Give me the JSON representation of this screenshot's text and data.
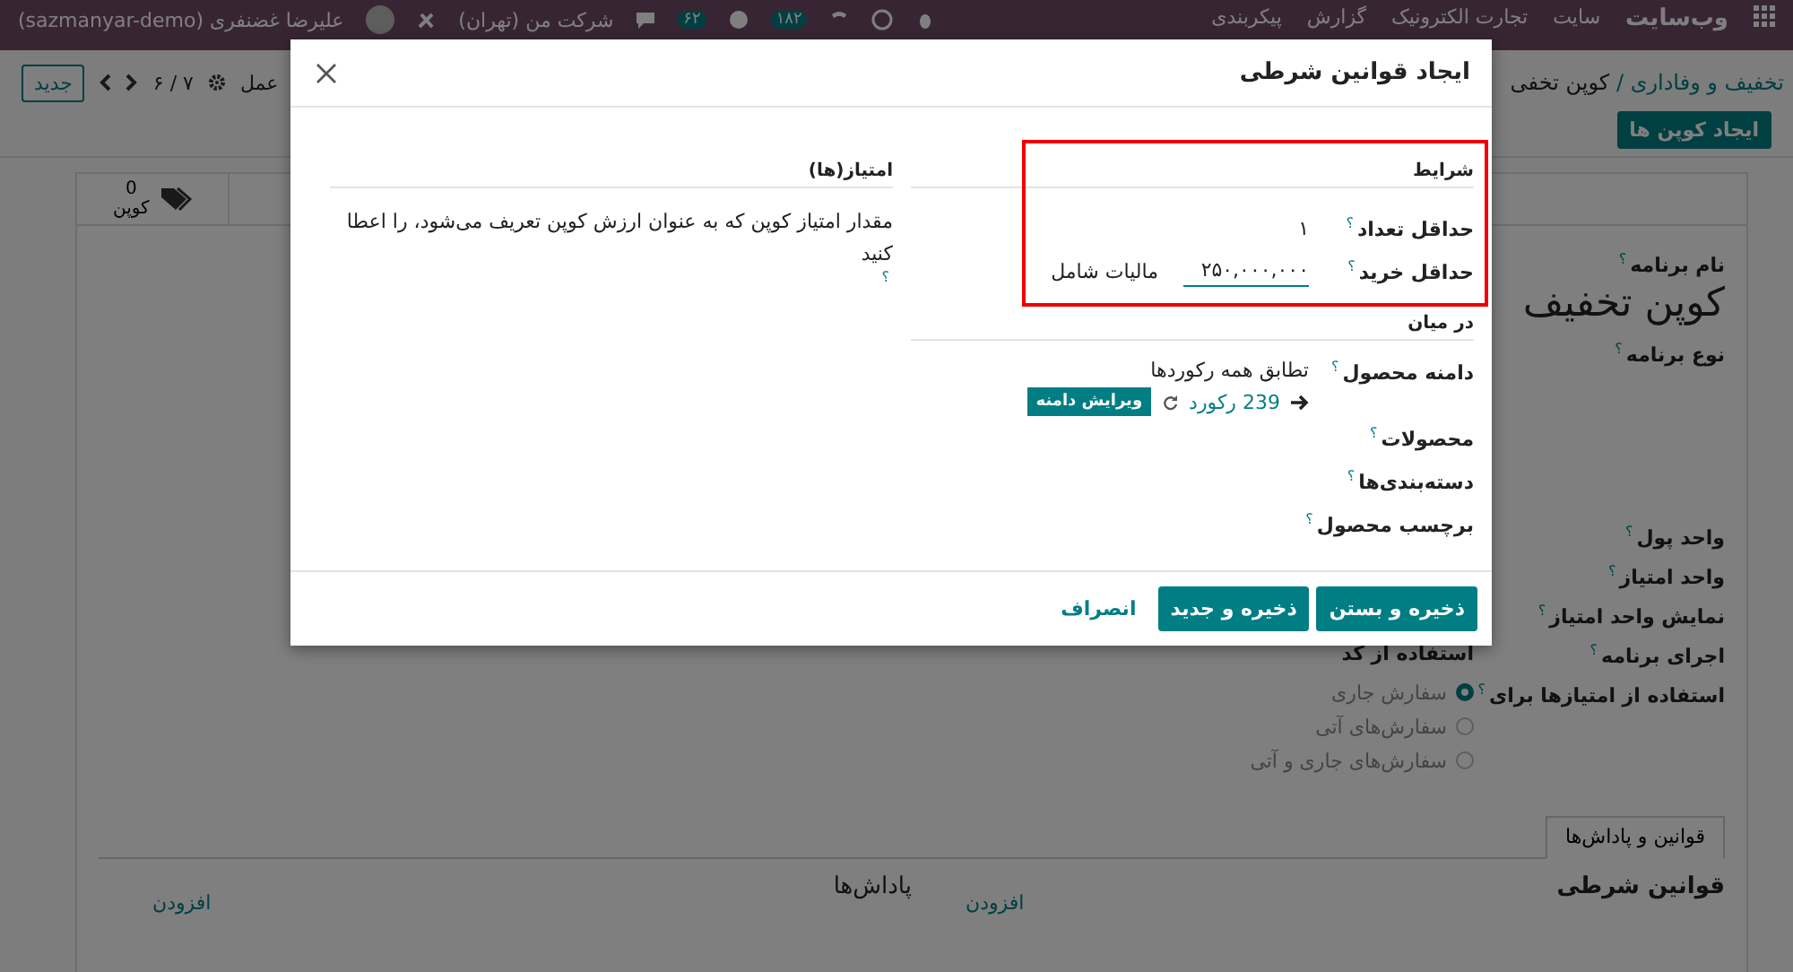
{
  "topbar": {
    "brand": "وب‌سایت",
    "menu": [
      "سایت",
      "تجارت الکترونیک",
      "گزارش",
      "پیکربندی"
    ],
    "company": "شرکت من (تهران)",
    "messages_badge": "۶۲",
    "activities_badge": "۱۸۲",
    "user": "علیرضا غضنفری (sazmanyar-demo)"
  },
  "control_panel": {
    "breadcrumb": [
      "تخفیف و وفاداری",
      "کوپن تخفی"
    ],
    "breadcrumb_separator": "/",
    "action": "عمل",
    "pager": "۷ / ۶",
    "new_button": "جدید",
    "create_button": "ایجاد کوپن ها"
  },
  "form": {
    "smart_button": {
      "count": "0",
      "label": "کوپن"
    },
    "name_label": {
      "label": "نام برنامه",
      "help": "؟"
    },
    "title": "کوپن تخفیف",
    "type_field": {
      "label": "نوع برنامه",
      "help": "؟"
    },
    "fields": [
      {
        "label": "واحد پول",
        "help": "؟"
      },
      {
        "label": "واحد امتیاز",
        "help": "؟"
      },
      {
        "label": "نمایش واحد امتیاز",
        "help": "؟"
      },
      {
        "label": "اجرای برنامه",
        "help": "؟",
        "value": "استفاده از کد"
      },
      {
        "label": "استفاده از امتیازها برای",
        "help": "؟",
        "options": [
          {
            "label": "سفارش جاری",
            "selected": true
          },
          {
            "label": "سفارش‌های آتی",
            "selected": false
          },
          {
            "label": "سفارش‌های جاری و آتی",
            "selected": false
          }
        ]
      }
    ],
    "tabs": [
      {
        "label": "قوانین و پاداش‌ها",
        "selected": true
      }
    ],
    "sections": [
      {
        "title": "قوانین شرطی",
        "add": "افزودن"
      },
      {
        "title": "پاداش‌ها",
        "add": "افزودن"
      }
    ]
  },
  "modal": {
    "title": "ایجاد قوانین شرطی",
    "conditions": {
      "heading": "شرایط",
      "rows": [
        {
          "kind": "text",
          "label": "حداقل تعداد",
          "help": "؟",
          "value": "۱"
        },
        {
          "kind": "input",
          "label": "حداقل خرید",
          "help": "؟",
          "value": "۲۵۰,۰۰۰,۰۰۰",
          "suffix": "مالیات شامل"
        }
      ]
    },
    "among": {
      "heading": "در میان",
      "domain": {
        "label": "دامنه محصول",
        "help": "؟",
        "value": "تطابق همه رکوردها",
        "records": "239 رکورد",
        "edit_button": "ویرایش دامنه"
      },
      "rows": [
        {
          "label": "محصولات",
          "help": "؟"
        },
        {
          "label": "دسته‌بندی‌ها",
          "help": "؟"
        },
        {
          "label": "برچسب محصول",
          "help": "؟"
        }
      ]
    },
    "points": {
      "heading": "امتیاز(ها)",
      "text": "مقدار امتیاز کوپن که به عنوان ارزش کوپن تعریف می‌شود، را اعطا کنید",
      "help": "؟"
    },
    "buttons": [
      {
        "kind": "primary",
        "label": "ذخیره و بستن"
      },
      {
        "kind": "primary",
        "label": "ذخیره و جدید"
      },
      {
        "kind": "link",
        "label": "انصراف"
      }
    ]
  }
}
